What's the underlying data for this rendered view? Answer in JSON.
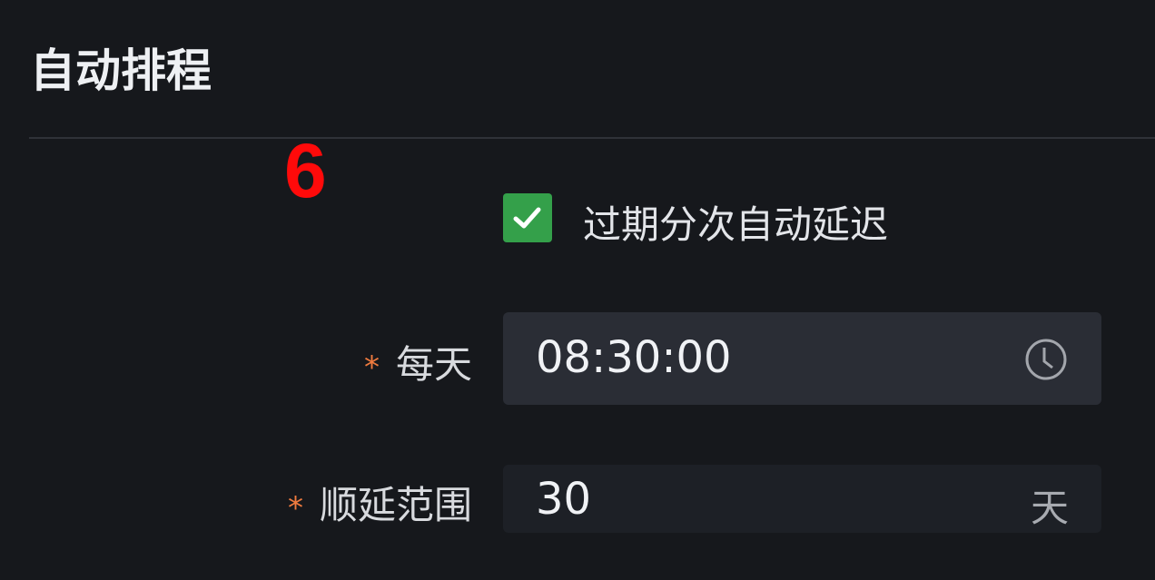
{
  "section": {
    "title": "自动排程"
  },
  "annotation": {
    "marker": "6"
  },
  "auto_delay": {
    "label": "过期分次自动延迟",
    "checked": true
  },
  "daily_time": {
    "required_mark": "*",
    "label": "每天",
    "value": "08:30:00",
    "icon": "clock-icon"
  },
  "delay_range": {
    "required_mark": "*",
    "label": "顺延范围",
    "value": "30",
    "unit": "天"
  },
  "colors": {
    "checkbox": "#34a04a",
    "required": "#f07b3f",
    "marker": "#ff0a0a"
  }
}
